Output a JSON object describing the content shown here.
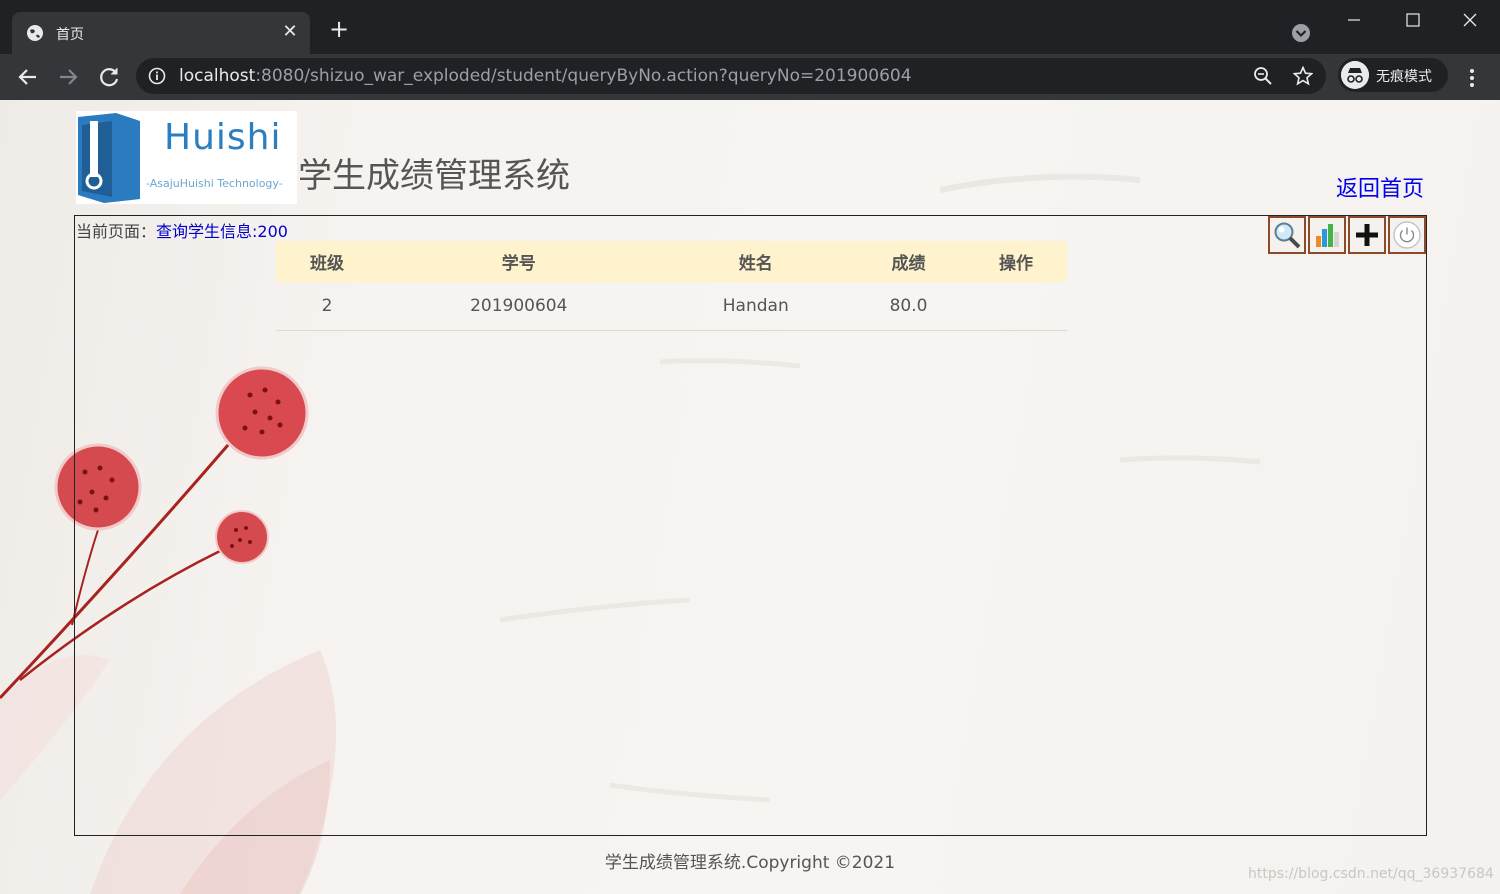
{
  "browser": {
    "tab_title": "首页",
    "new_tab": "+",
    "url_host": "localhost",
    "url_rest": ":8080/shizuo_war_exploded/student/queryByNo.action?queryNo=201900604",
    "incognito_label": "无痕模式"
  },
  "header": {
    "logo_word": "Huishi",
    "logo_sub": "-AsajuHuishi Technology-",
    "system_title": "学生成绩管理系统",
    "back_home": "返回首页"
  },
  "breadcrumb": {
    "prefix": "当前页面：",
    "current": "查询学生信息:200"
  },
  "action_icons": [
    "search-icon",
    "chart-icon",
    "add-icon",
    "power-icon"
  ],
  "table": {
    "columns": [
      "班级",
      "学号",
      "姓名",
      "成绩",
      "操作"
    ],
    "rows": [
      [
        "2",
        "201900604",
        "Handan",
        "80.0",
        ""
      ]
    ]
  },
  "footer": {
    "copyright": "学生成绩管理系统.Copyright ©2021"
  },
  "watermark": "https://blog.csdn.net/qq_36937684",
  "colors": {
    "header_row": "#fff3cd",
    "link": "#0000ee",
    "action_border": "#8b4a2a"
  }
}
